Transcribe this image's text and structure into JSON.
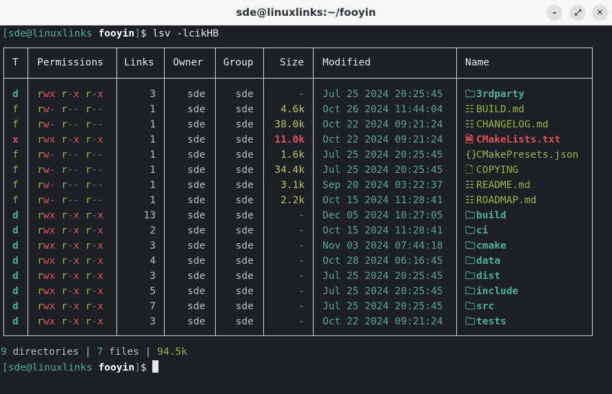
{
  "window": {
    "title": "sde@linuxlinks:~/fooyin",
    "buttons": [
      "–",
      "⤢",
      "✕"
    ]
  },
  "prompt": {
    "user": "sde@linuxlinks",
    "dir": "fooyin",
    "symbol": "$"
  },
  "command": "lsv -lcikHB",
  "table": {
    "headers": [
      "T",
      "Permissions",
      "Links",
      "Owner",
      "Group",
      "Size",
      "Modified",
      "Name"
    ],
    "rows": [
      {
        "t": "d",
        "perm": "rwx r-x r-x",
        "links": "3",
        "owner": "sde",
        "group": "sde",
        "size": "-",
        "modified": "Jul 25 2024 20:25:45",
        "icon": "folder-icon",
        "name": "3rdparty"
      },
      {
        "t": "f",
        "perm": "rw- r-- r--",
        "links": "1",
        "owner": "sde",
        "group": "sde",
        "size": "4.6k",
        "modified": "Oct 26 2024 11:44:04",
        "icon": "markdown-icon",
        "name": "BUILD.md"
      },
      {
        "t": "f",
        "perm": "rw- r-- r--",
        "links": "1",
        "owner": "sde",
        "group": "sde",
        "size": "38.0k",
        "modified": "Oct 22 2024 09:21:24",
        "icon": "markdown-icon",
        "name": "CHANGELOG.md"
      },
      {
        "t": "x",
        "perm": "rwx r-x r-x",
        "links": "1",
        "owner": "sde",
        "group": "sde",
        "size": "11.0k",
        "modified": "Oct 22 2024 09:21:24",
        "icon": "text-file-icon",
        "name": "CMakeLists.txt"
      },
      {
        "t": "f",
        "perm": "rw- r-- r--",
        "links": "1",
        "owner": "sde",
        "group": "sde",
        "size": "1.6k",
        "modified": "Jul 25 2024 20:25:45",
        "icon": "json-icon",
        "name": "CMakePresets.json"
      },
      {
        "t": "f",
        "perm": "rw- r-- r--",
        "links": "1",
        "owner": "sde",
        "group": "sde",
        "size": "34.4k",
        "modified": "Jul 25 2024 20:25:45",
        "icon": "file-icon",
        "name": "COPYING"
      },
      {
        "t": "f",
        "perm": "rw- r-- r--",
        "links": "1",
        "owner": "sde",
        "group": "sde",
        "size": "3.1k",
        "modified": "Sep 20 2024 03:22:37",
        "icon": "markdown-icon",
        "name": "README.md"
      },
      {
        "t": "f",
        "perm": "rw- r-- r--",
        "links": "1",
        "owner": "sde",
        "group": "sde",
        "size": "2.2k",
        "modified": "Oct 15 2024 11:28:41",
        "icon": "markdown-icon",
        "name": "ROADMAP.md"
      },
      {
        "t": "d",
        "perm": "rwx r-x r-x",
        "links": "13",
        "owner": "sde",
        "group": "sde",
        "size": "-",
        "modified": "Dec 05 2024 10:27:05",
        "icon": "folder-icon",
        "name": "build"
      },
      {
        "t": "d",
        "perm": "rwx r-x r-x",
        "links": "2",
        "owner": "sde",
        "group": "sde",
        "size": "-",
        "modified": "Oct 15 2024 11:28:41",
        "icon": "folder-icon",
        "name": "ci"
      },
      {
        "t": "d",
        "perm": "rwx r-x r-x",
        "links": "3",
        "owner": "sde",
        "group": "sde",
        "size": "-",
        "modified": "Nov 03 2024 07:44:18",
        "icon": "folder-icon",
        "name": "cmake"
      },
      {
        "t": "d",
        "perm": "rwx r-x r-x",
        "links": "4",
        "owner": "sde",
        "group": "sde",
        "size": "-",
        "modified": "Oct 28 2024 06:16:45",
        "icon": "folder-icon",
        "name": "data"
      },
      {
        "t": "d",
        "perm": "rwx r-x r-x",
        "links": "3",
        "owner": "sde",
        "group": "sde",
        "size": "-",
        "modified": "Jul 25 2024 20:25:45",
        "icon": "folder-icon",
        "name": "dist"
      },
      {
        "t": "d",
        "perm": "rwx r-x r-x",
        "links": "5",
        "owner": "sde",
        "group": "sde",
        "size": "-",
        "modified": "Jul 25 2024 20:25:45",
        "icon": "folder-icon",
        "name": "include"
      },
      {
        "t": "d",
        "perm": "rwx r-x r-x",
        "links": "7",
        "owner": "sde",
        "group": "sde",
        "size": "-",
        "modified": "Jul 25 2024 20:25:45",
        "icon": "folder-icon",
        "name": "src"
      },
      {
        "t": "d",
        "perm": "rwx r-x r-x",
        "links": "3",
        "owner": "sde",
        "group": "sde",
        "size": "-",
        "modified": "Oct 22 2024 09:21:24",
        "icon": "folder-icon",
        "name": "tests"
      }
    ]
  },
  "summary": {
    "dir_count": "9",
    "dir_label": "directories",
    "file_count": "7",
    "file_label": "files",
    "total_size": "94.5k",
    "sep": "|"
  }
}
